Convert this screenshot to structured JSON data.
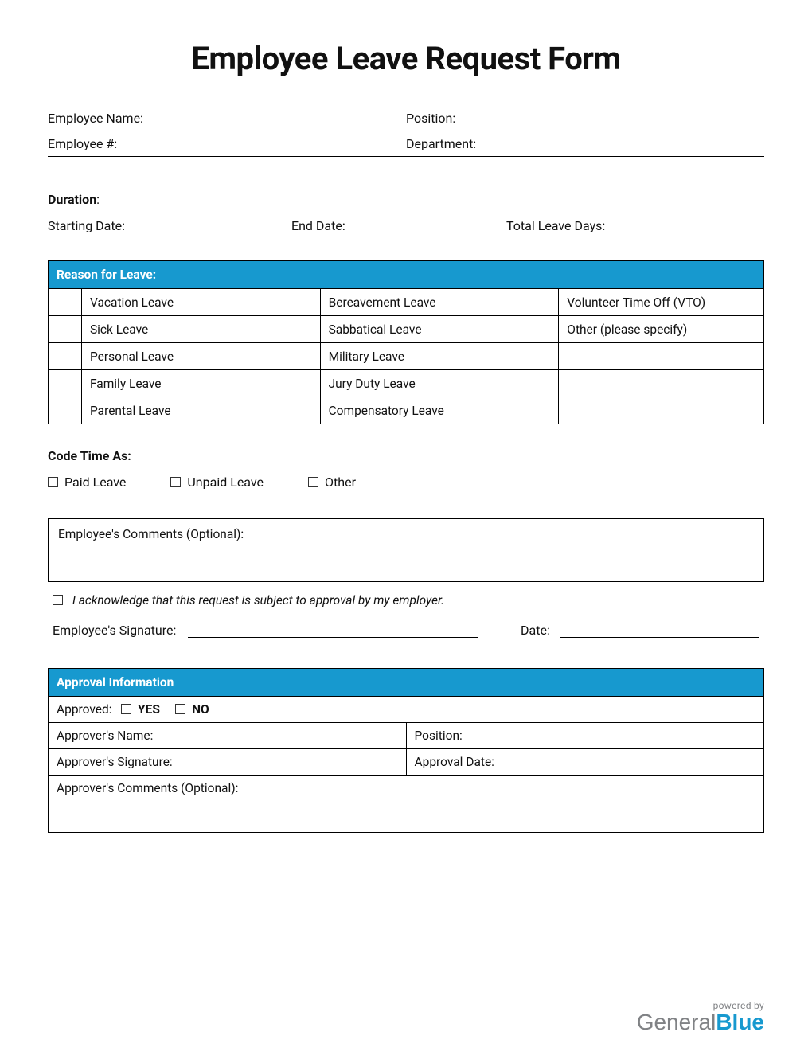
{
  "title": "Employee Leave Request Form",
  "info": {
    "employee_name": "Employee Name:",
    "position": "Position:",
    "employee_num": "Employee #:",
    "department": "Department:"
  },
  "duration": {
    "heading": "Duration",
    "start": "Starting Date:",
    "end": "End Date:",
    "total": "Total Leave Days:"
  },
  "reason": {
    "header": "Reason for Leave:",
    "col1": [
      "Vacation Leave",
      "Sick Leave",
      "Personal Leave",
      "Family Leave",
      "Parental Leave"
    ],
    "col2": [
      "Bereavement Leave",
      "Sabbatical Leave",
      "Military Leave",
      "Jury Duty Leave",
      "Compensatory Leave"
    ],
    "col3": [
      "Volunteer Time Off (VTO)",
      "Other (please specify)",
      "",
      "",
      ""
    ]
  },
  "code": {
    "heading": "Code Time As:",
    "paid": "Paid Leave",
    "unpaid": "Unpaid Leave",
    "other": "Other"
  },
  "comments_label": "Employee's Comments (Optional):",
  "ack_text": "I acknowledge that this request is subject to approval by my employer.",
  "signature": {
    "label": "Employee's Signature:",
    "date": "Date:"
  },
  "approval": {
    "header": "Approval Information",
    "approved": "Approved:",
    "yes": "YES",
    "no": "NO",
    "approver_name": "Approver's Name:",
    "position": "Position:",
    "approver_sig": "Approver's Signature:",
    "approval_date": "Approval Date:",
    "approver_comments": "Approver's Comments (Optional):"
  },
  "footer": {
    "powered": "powered by",
    "brand_a": "General",
    "brand_b": "Blue"
  }
}
